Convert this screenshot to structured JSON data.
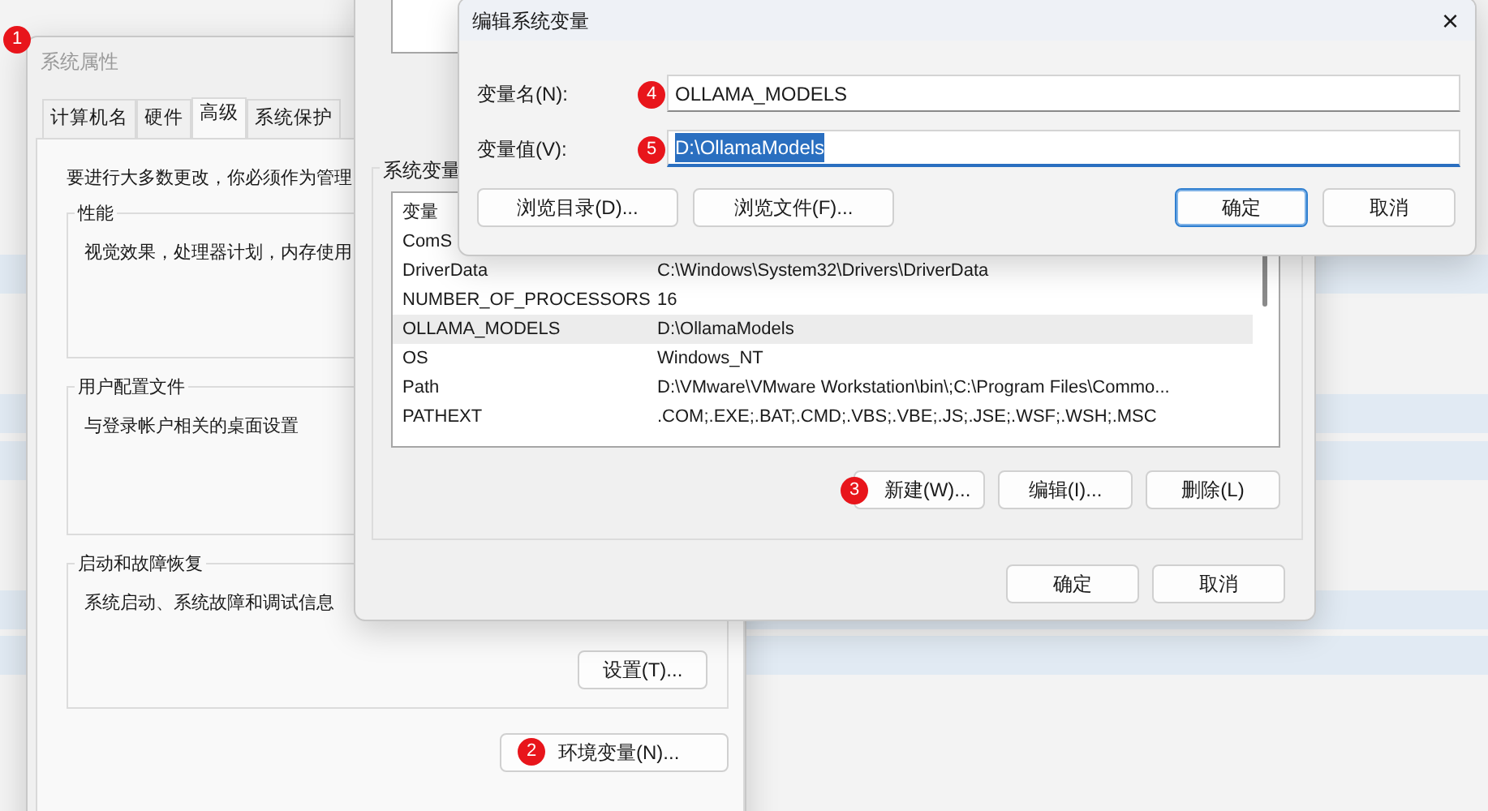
{
  "system_properties": {
    "title": "系统属性",
    "active": false,
    "badge": "1",
    "tabs": [
      {
        "label": "计算机名",
        "selected": false
      },
      {
        "label": "硬件",
        "selected": false
      },
      {
        "label": "高级",
        "selected": true
      },
      {
        "label": "系统保护",
        "selected": false
      }
    ],
    "notice": "要进行大多数更改，你必须作为管理",
    "groups": [
      {
        "title": "性能",
        "description": "视觉效果，处理器计划，内存使用"
      },
      {
        "title": "用户配置文件",
        "description": "与登录帐户相关的桌面设置"
      },
      {
        "title": "启动和故障恢复",
        "description": "系统启动、系统故障和调试信息",
        "button": "设置(T)..."
      }
    ],
    "env_button": {
      "label": "环境变量(N)...",
      "badge": "2"
    }
  },
  "environment_variables": {
    "section_title": "系统变量",
    "columns": [
      "变量"
    ],
    "rows": [
      {
        "name": "ComS",
        "selected": false
      },
      {
        "name": "DriverData",
        "value": "C:\\Windows\\System32\\Drivers\\DriverData",
        "selected": false
      },
      {
        "name": "NUMBER_OF_PROCESSORS",
        "value": "16",
        "selected": false
      },
      {
        "name": "OLLAMA_MODELS",
        "value": "D:\\OllamaModels",
        "selected": true
      },
      {
        "name": "OS",
        "value": "Windows_NT",
        "selected": false
      },
      {
        "name": "Path",
        "value": "D:\\VMware\\VMware Workstation\\bin\\;C:\\Program Files\\Commo...",
        "selected": false
      },
      {
        "name": "PATHEXT",
        "value": ".COM;.EXE;.BAT;.CMD;.VBS;.VBE;.JS;.JSE;.WSF;.WSH;.MSC",
        "selected": false
      }
    ],
    "list_buttons": [
      {
        "label": "新建(W)...",
        "badge": "3"
      },
      {
        "label": "编辑(I)..."
      },
      {
        "label": "删除(L)"
      }
    ],
    "dialog_buttons": [
      "确定",
      "取消"
    ]
  },
  "edit_dialog": {
    "title": "编辑系统变量",
    "active": true,
    "close": "×",
    "fields": [
      {
        "label": "变量名(N):",
        "badge": "4",
        "value": "OLLAMA_MODELS",
        "focused": false
      },
      {
        "label": "变量值(V):",
        "badge": "5",
        "value": "D:\\OllamaModels",
        "focused": true
      }
    ],
    "buttons": [
      {
        "label": "浏览目录(D)...",
        "default": false
      },
      {
        "label": "浏览文件(F)...",
        "default": false
      },
      {
        "label": "确定",
        "default": true
      },
      {
        "label": "取消",
        "default": false
      }
    ]
  }
}
